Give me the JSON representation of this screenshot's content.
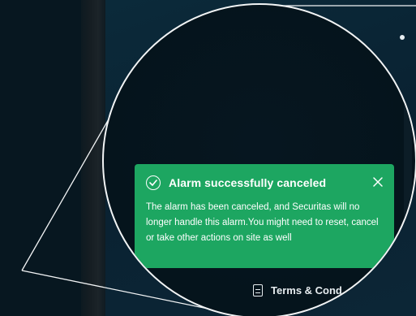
{
  "toast": {
    "title": "Alarm successfully canceled",
    "message": "The alarm has been canceled, and Securitas will no longer handle this alarm.You might need to reset, cancel or take other actions on site as well",
    "status": "success",
    "accent_color": "#1da661",
    "icons": {
      "status": "check-circle-icon",
      "close": "close-icon"
    }
  },
  "footer": {
    "terms_label": "Terms & Cond",
    "icon": "document-icon"
  },
  "colors": {
    "background": "#06161f",
    "panel": "#0b2a3a",
    "callout_stroke": "#f2f4f5"
  }
}
